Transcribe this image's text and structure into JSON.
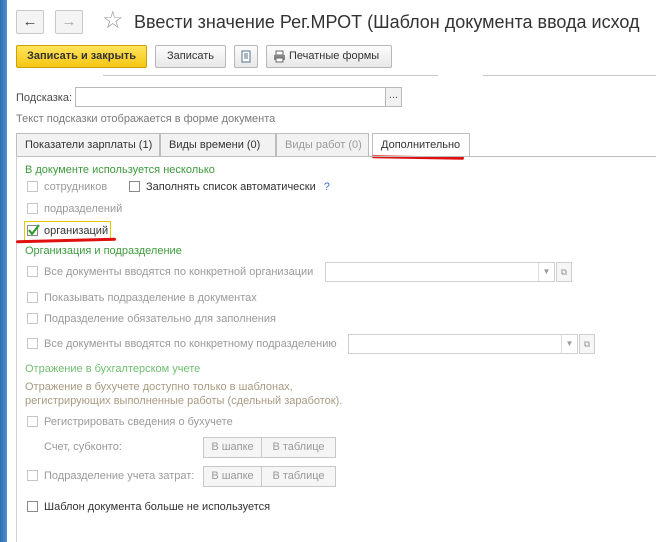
{
  "window": {
    "title": "Ввести значение Рег.МРОТ (Шаблон документа ввода исход",
    "back_icon": "arrow-left-icon",
    "forward_icon": "arrow-right-icon",
    "favorite_icon": "star-icon"
  },
  "toolbar": {
    "save_close": "Записать и закрыть",
    "save": "Записать",
    "print_forms": "Печатные формы"
  },
  "hint": {
    "label": "Подсказка:",
    "value": "",
    "dots": "...",
    "description": "Текст подсказки отображается в форме документа"
  },
  "tabs": [
    {
      "label": "Показатели зарплаты (1)",
      "state": "normal"
    },
    {
      "label": "Виды времени (0)",
      "state": "normal"
    },
    {
      "label": "Виды работ (0)",
      "state": "disabled"
    },
    {
      "label": "Дополнительно",
      "state": "active"
    }
  ],
  "doc_usage": {
    "title": "В документе используется несколько",
    "employees": {
      "label": "сотрудников",
      "checked": false
    },
    "autofill": {
      "label": "Заполнять список автоматически",
      "checked": false,
      "help": "?"
    },
    "departments": {
      "label": "подразделений",
      "checked": false
    },
    "organizations": {
      "label": "организаций",
      "checked": true
    }
  },
  "org_dept": {
    "title": "Организация и подразделение",
    "all_docs_org": {
      "label": "Все документы вводятся по конкретной организации",
      "checked": false
    },
    "show_dept": {
      "label": "Показывать подразделение в документах",
      "checked": false
    },
    "dept_required": {
      "label": "Подразделение обязательно для заполнения",
      "checked": false
    },
    "all_docs_dept": {
      "label": "Все документы вводятся по конкретному подразделению",
      "checked": false
    }
  },
  "accounting": {
    "title": "Отражение в бухгалтерском учете",
    "note_line1": "Отражение в бухучете доступно только в шаблонах,",
    "note_line2": "регистрирующих выполненные работы (сдельный заработок).",
    "register": {
      "label": "Регистрировать сведения о бухучете",
      "checked": false
    },
    "account_label": "Счет, субконто:",
    "in_header": "В шапке",
    "in_table": "В таблице",
    "cost_dept": {
      "label": "Подразделение учета затрат:",
      "checked": false
    }
  },
  "template_unused": {
    "label": "Шаблон документа больше не используется",
    "checked": false
  },
  "colors": {
    "accent_green": "#3d9a3d",
    "primary_yellow": "#f5c614",
    "annotation_red": "#e01010"
  }
}
